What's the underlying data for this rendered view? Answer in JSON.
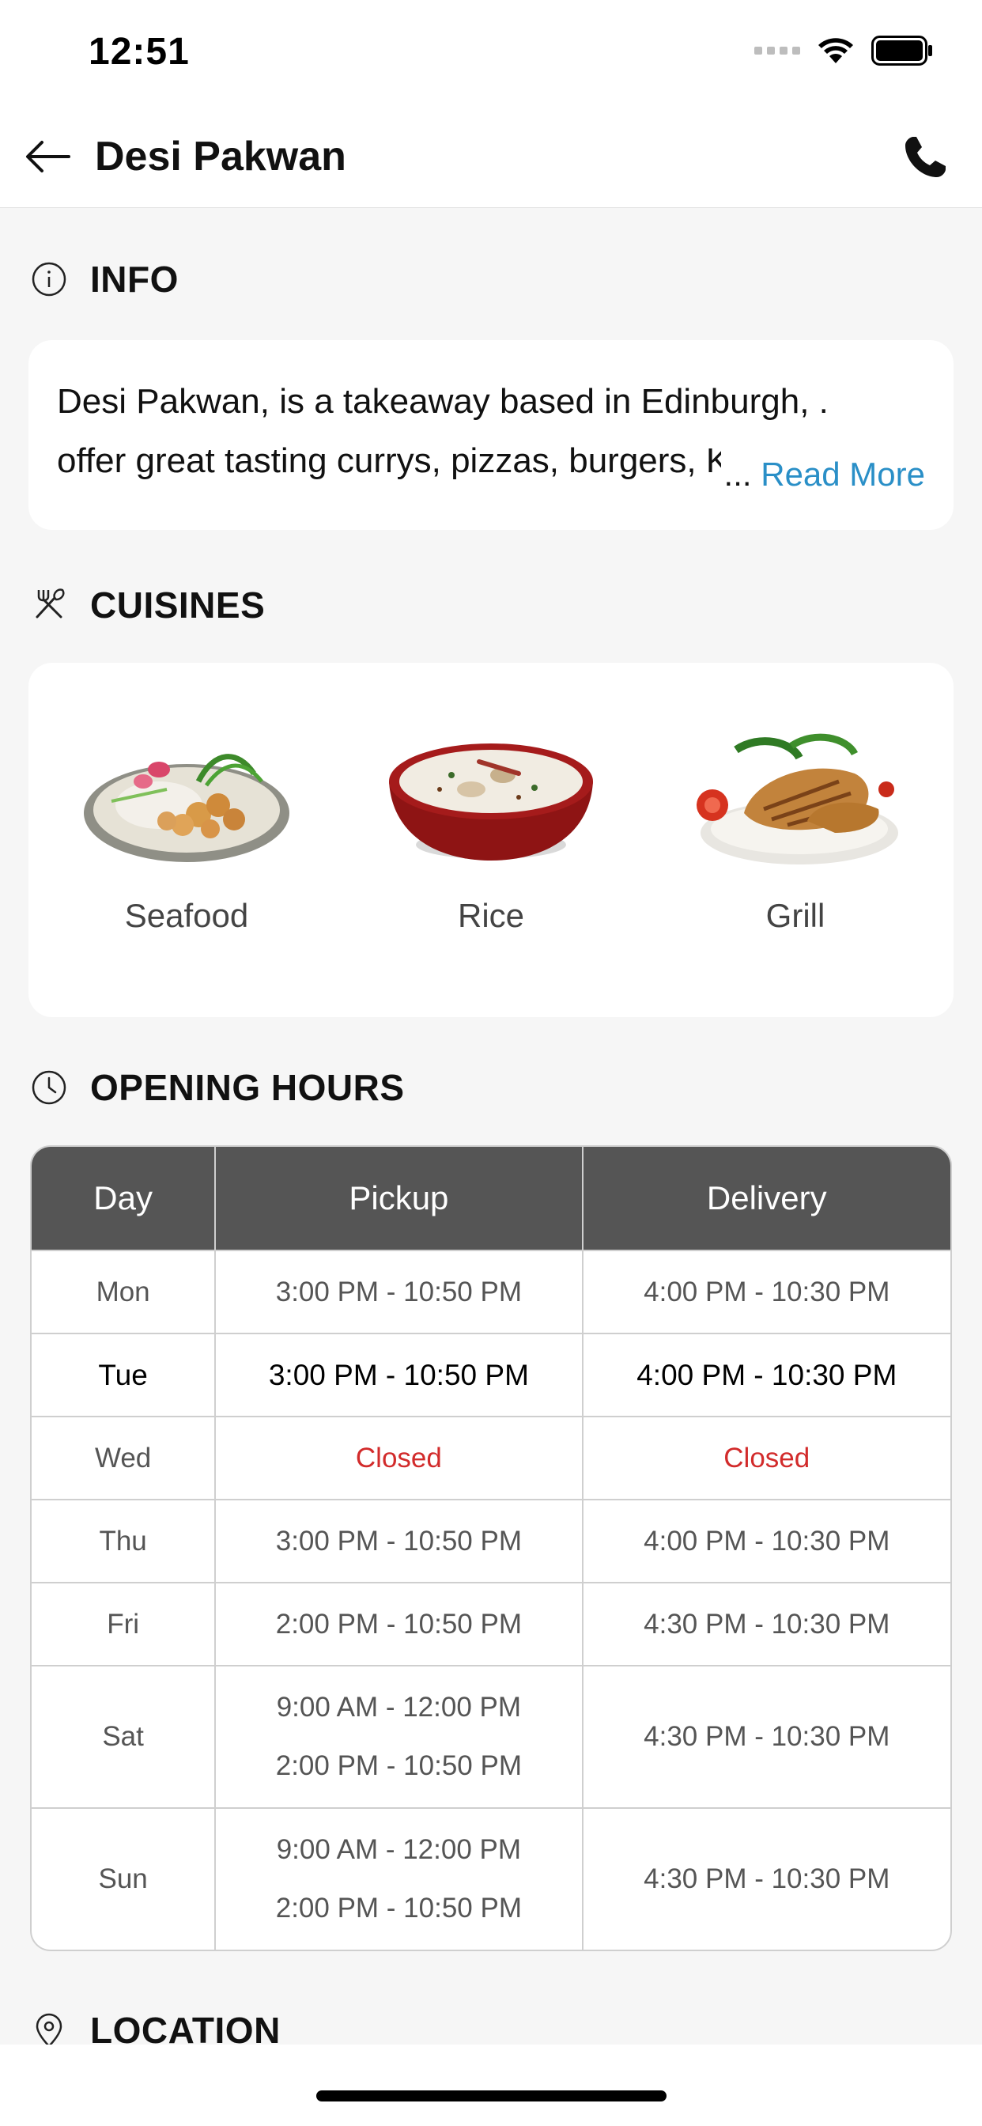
{
  "status_bar": {
    "time": "12:51"
  },
  "header": {
    "title": "Desi Pakwan",
    "back_icon": "arrow-left-icon",
    "call_icon": "phone-icon"
  },
  "sections": {
    "info": {
      "title": "INFO",
      "icon": "info-circle-icon",
      "text": "Desi Pakwan, is a takeaway based in Edinburgh, . offer great tasting currys, pizzas, burgers, Kebabs",
      "ellipsis": "...",
      "read_more": "Read More"
    },
    "cuisines": {
      "title": "CUISINES",
      "icon": "utensils-icon",
      "items": [
        {
          "label": "Seafood"
        },
        {
          "label": "Rice"
        },
        {
          "label": "Grill"
        }
      ]
    },
    "opening_hours": {
      "title": "OPENING HOURS",
      "icon": "clock-icon",
      "headers": {
        "day": "Day",
        "pickup": "Pickup",
        "delivery": "Delivery"
      },
      "rows": [
        {
          "day": "Mon",
          "pickup": [
            "3:00 PM - 10:50 PM"
          ],
          "delivery": "4:00 PM - 10:30 PM"
        },
        {
          "day": "Tue",
          "pickup": [
            "3:00 PM - 10:50 PM"
          ],
          "delivery": "4:00 PM - 10:30 PM"
        },
        {
          "day": "Wed",
          "pickup": [
            "Closed"
          ],
          "delivery": "Closed"
        },
        {
          "day": "Thu",
          "pickup": [
            "3:00 PM - 10:50 PM"
          ],
          "delivery": "4:00 PM - 10:30 PM"
        },
        {
          "day": "Fri",
          "pickup": [
            "2:00 PM - 10:50 PM"
          ],
          "delivery": "4:30 PM - 10:30 PM"
        },
        {
          "day": "Sat",
          "pickup": [
            "9:00 AM - 12:00 PM",
            "2:00 PM - 10:50 PM"
          ],
          "delivery": "4:30 PM - 10:30 PM"
        },
        {
          "day": "Sun",
          "pickup": [
            "9:00 AM - 12:00 PM",
            "2:00 PM - 10:50 PM"
          ],
          "delivery": "4:30 PM - 10:30 PM"
        }
      ]
    },
    "location": {
      "title": "LOCATION",
      "icon": "map-pin-icon"
    }
  },
  "colors": {
    "accent_link": "#2a8fc7",
    "closed": "#d22b2b",
    "table_header": "#555555",
    "background": "#f6f6f6"
  }
}
